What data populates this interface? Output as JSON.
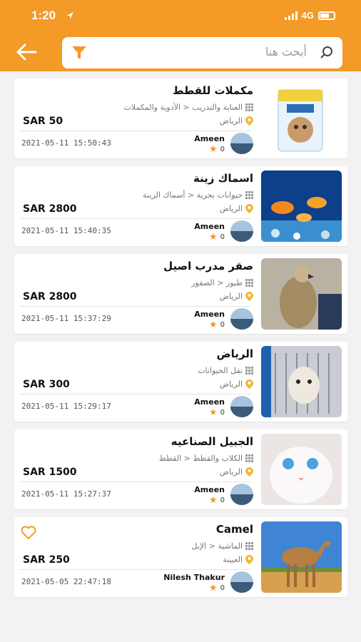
{
  "status_bar": {
    "time": "1:20",
    "network": "4G"
  },
  "header": {
    "search_placeholder": "أبحث هنا",
    "colors": {
      "accent": "#f39a27",
      "price": "#111111",
      "star": "#f39a27"
    }
  },
  "listings": [
    {
      "title": "مكملات للقطط",
      "category": "العناية والتدريب < الأدوية والمكملات",
      "location": "الرياض",
      "price": "SAR 50",
      "date": "2021-05-11 15:50:43",
      "seller": "Ameen",
      "rating": "0",
      "photo": "cat-yoghurt-product",
      "favorite": false
    },
    {
      "title": "اسماك زينة",
      "category": "حيوانات بحرية < أسماك الزينة",
      "location": "الرياض",
      "price": "SAR 2800",
      "date": "2021-05-11 15:40:35",
      "seller": "Ameen",
      "rating": "0",
      "photo": "aquarium-fish",
      "favorite": false
    },
    {
      "title": "صقر مدرب اصيل",
      "category": "طيور < الصقور",
      "location": "الرياض",
      "price": "SAR 2800",
      "date": "2021-05-11 15:37:29",
      "seller": "Ameen",
      "rating": "0",
      "photo": "falcon",
      "favorite": false
    },
    {
      "title": "الرياض",
      "category": "نقل الحيوانات",
      "location": "الرياض",
      "price": "SAR 300",
      "date": "2021-05-11 15:29:17",
      "seller": "Ameen",
      "rating": "0",
      "photo": "dog-crate",
      "favorite": false
    },
    {
      "title": "الجبيل الصناعيه",
      "category": "الكلاب والقطط < القطط",
      "location": "الرياض",
      "price": "SAR 1500",
      "date": "2021-05-11 15:27:37",
      "seller": "Ameen",
      "rating": "0",
      "photo": "white-kitten",
      "favorite": false
    },
    {
      "title": "Camel",
      "category": "الماشية < الإبل",
      "location": "العيينة",
      "price": "SAR 250",
      "date": "2021-05-05 22:47:18",
      "seller": "Nilesh Thakur",
      "rating": "0",
      "photo": "camel",
      "favorite": true
    }
  ]
}
